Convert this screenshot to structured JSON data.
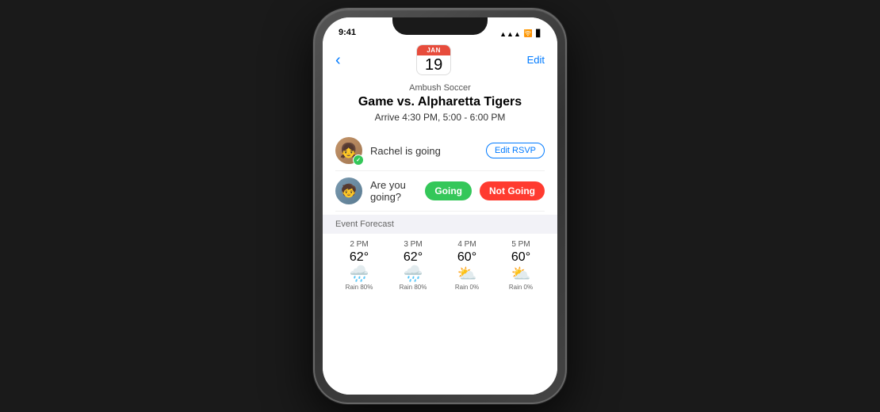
{
  "phone": {
    "status": {
      "time": "9:41",
      "signal": "▲▲▲",
      "wifi": "WiFi",
      "battery": "Battery"
    }
  },
  "nav": {
    "back_label": "‹",
    "edit_label": "Edit"
  },
  "date": {
    "month": "JAN",
    "day": "19"
  },
  "event": {
    "org": "Ambush Soccer",
    "title": "Game vs. Alpharetta Tigers",
    "time": "Arrive 4:30 PM, 5:00 - 6:00 PM"
  },
  "rsvp": {
    "rachel_status": "Rachel is going",
    "edit_rsvp_label": "Edit RSVP",
    "question": "Are you going?",
    "going_label": "Going",
    "not_going_label": "Not Going"
  },
  "forecast": {
    "section_label": "Event Forecast",
    "items": [
      {
        "time": "2 PM",
        "temp": "62°",
        "icon": "🌧️",
        "desc": "Rain 80%"
      },
      {
        "time": "3 PM",
        "temp": "62°",
        "icon": "🌧️",
        "desc": "Rain 80%"
      },
      {
        "time": "4 PM",
        "temp": "60°",
        "icon": "⛅",
        "desc": "Rain 0%"
      },
      {
        "time": "5 PM",
        "temp": "60°",
        "icon": "⛅",
        "desc": "Rain 0%"
      }
    ]
  }
}
